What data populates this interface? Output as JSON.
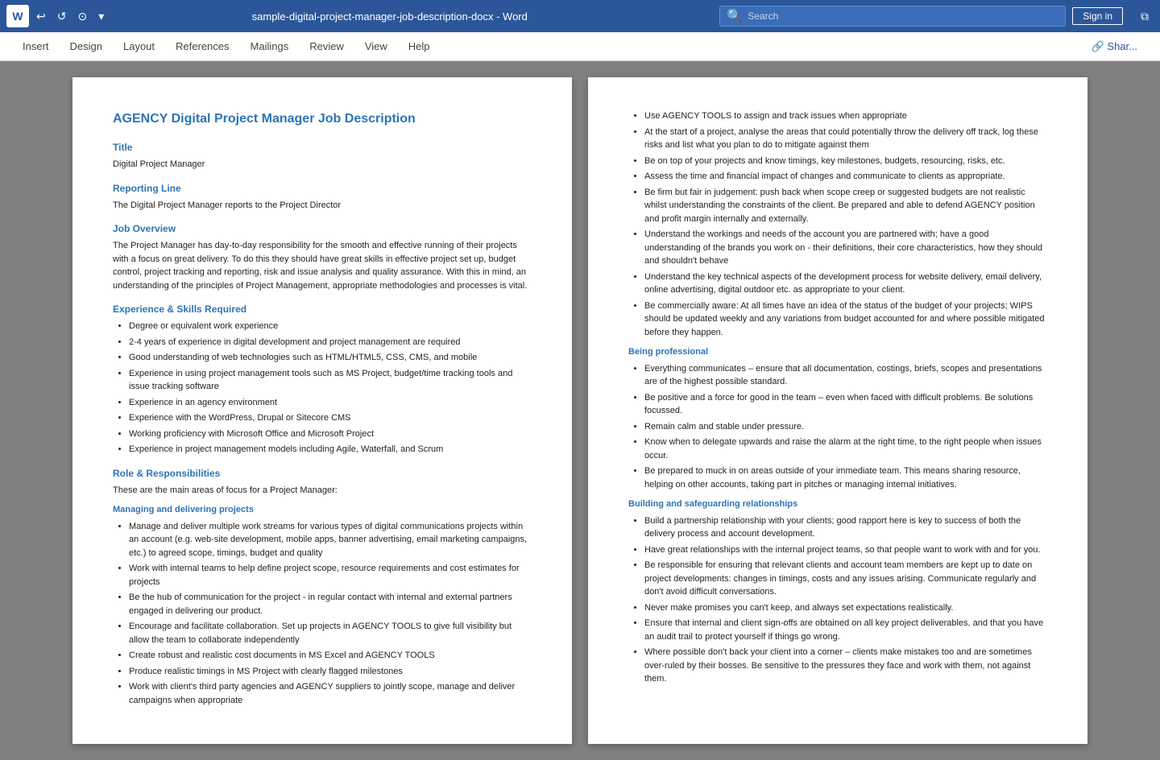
{
  "titlebar": {
    "filename": "sample-digital-project-manager-job-description-docx",
    "app": "Word",
    "full_title": "sample-digital-project-manager-job-description-docx  -  Word",
    "search_placeholder": "Search",
    "signin_label": "Sign in",
    "word_letter": "W"
  },
  "ribbon": {
    "tabs": [
      "Insert",
      "Design",
      "Layout",
      "References",
      "Mailings",
      "Review",
      "View",
      "Help"
    ],
    "share_label": "🔗 Shar..."
  },
  "page1": {
    "doc_title": "AGENCY Digital Project Manager Job Description",
    "sections": [
      {
        "heading": "Title",
        "content": "Digital Project Manager"
      },
      {
        "heading": "Reporting Line",
        "content": "The Digital Project Manager reports to the Project Director"
      },
      {
        "heading": "Job Overview",
        "content": "The Project Manager has day-to-day responsibility for the smooth and effective running of their projects with a focus on great delivery. To do this they should have great skills in effective project set up, budget control, project tracking and reporting, risk and issue analysis and quality assurance. With this in mind, an understanding of the principles of Project Management, appropriate methodologies and processes is vital."
      },
      {
        "heading": "Experience & Skills Required",
        "bullets": [
          "Degree or equivalent work experience",
          "2-4 years of experience in digital development and project management are required",
          "Good understanding of web technologies such as HTML/HTML5, CSS, CMS, and mobile",
          "Experience in using project management tools such as MS Project, budget/time tracking tools and issue tracking software",
          "Experience in an agency environment",
          "Experience with the WordPress, Drupal or Sitecore CMS",
          "Working proficiency with Microsoft Office and Microsoft Project",
          "Experience in project management models including Agile, Waterfall, and Scrum"
        ]
      },
      {
        "heading": "Role & Responsibilities",
        "content": "These are the main areas of focus for a Project Manager:"
      },
      {
        "subheading": "Managing and delivering projects",
        "bullets": [
          "Manage and deliver multiple work streams for various types of digital communications projects within an account (e.g. web-site development, mobile apps, banner advertising, email marketing campaigns, etc.) to agreed scope, timings, budget and quality",
          "Work with internal teams to help define project scope, resource requirements and cost estimates for projects",
          "Be the hub of communication for the project - in regular contact with internal and external partners engaged in delivering our product.",
          "Encourage and facilitate collaboration. Set up projects in AGENCY TOOLS to give full visibility but allow the team to collaborate independently",
          "Create robust and realistic cost documents in MS Excel and AGENCY TOOLS",
          "Produce realistic timings in MS Project with clearly flagged milestones",
          "Work with client's third party agencies and AGENCY suppliers to jointly scope, manage and deliver campaigns when appropriate"
        ]
      }
    ]
  },
  "page2": {
    "bullets_continued": [
      "Use AGENCY TOOLS to assign and track issues when appropriate",
      "At the start of a project, analyse the areas that could potentially throw the delivery off track, log these risks and list what you plan to do to mitigate against them",
      "Be on top of your projects and know timings, key milestones, budgets, resourcing, risks, etc.",
      "Assess the time and financial impact of changes and communicate to clients as appropriate.",
      "Be firm but fair in judgement: push back when scope creep or suggested budgets are not realistic whilst understanding the constraints of the client. Be prepared and able to defend AGENCY position and profit margin internally and externally.",
      "Understand the workings and needs of the account you are partnered with; have a good understanding of the brands you work on - their definitions, their core characteristics, how they should and shouldn't behave",
      "Understand the key technical aspects of the development process for website delivery, email delivery, online advertising, digital outdoor etc. as appropriate to your client.",
      "Be commercially aware: At all times have an idea of the status of the budget of your projects; WIPS should be updated weekly and any variations from budget accounted for and where possible mitigated before they happen."
    ],
    "sections": [
      {
        "subheading": "Being professional",
        "bullets": [
          "Everything communicates – ensure that all documentation, costings, briefs, scopes and presentations are of the highest possible standard.",
          "Be positive and a force for good in the team – even when faced with difficult problems. Be solutions focussed.",
          "Remain calm and stable under pressure.",
          "Know when to delegate upwards and raise the alarm at the right time, to the right people when issues occur.",
          "Be prepared to muck in on areas outside of your immediate team. This means sharing resource, helping on other accounts, taking part in pitches or managing internal initiatives."
        ]
      },
      {
        "subheading": "Building and safeguarding relationships",
        "bullets": [
          "Build a partnership relationship with your clients; good rapport here is key to success of both the delivery process and account development.",
          "Have great relationships with the internal project teams, so that people want to work with and for you.",
          "Be responsible for ensuring that relevant clients and account team members are kept up to date on project developments: changes in timings, costs and any issues arising. Communicate regularly and don't avoid difficult conversations.",
          "Never make promises you can't keep, and always set expectations realistically.",
          "Ensure that internal and client sign-offs are obtained on all key project deliverables, and that you have an audit trail to protect yourself if things go wrong.",
          "Where possible don't back your client into a corner – clients make mistakes too and are sometimes over-ruled by their bosses. Be sensitive to the pressures they face and work with them, not against them."
        ]
      }
    ]
  }
}
